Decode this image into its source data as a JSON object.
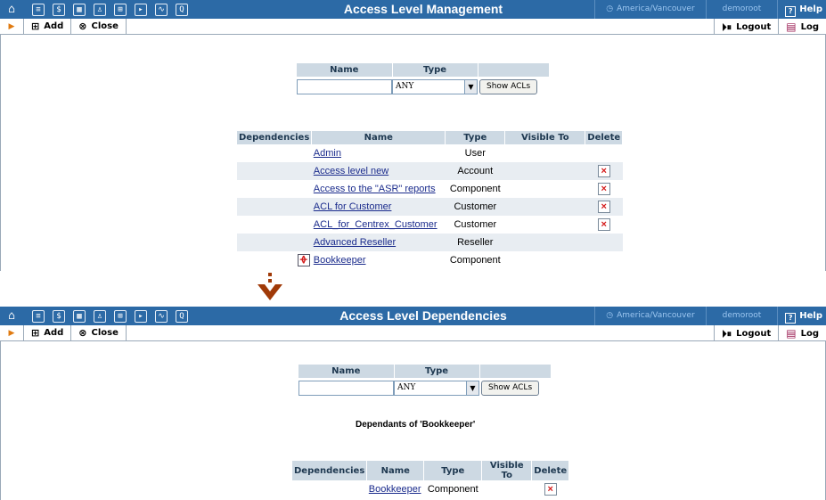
{
  "nav_icons": [
    {
      "name": "home-icon",
      "glyph": "⌂"
    },
    {
      "name": "list-icon",
      "glyph": "≡"
    },
    {
      "name": "dollar-icon",
      "glyph": "$"
    },
    {
      "name": "grid-icon",
      "glyph": "▦"
    },
    {
      "name": "person-icon",
      "glyph": "♙"
    },
    {
      "name": "tree-icon",
      "glyph": "⊞"
    },
    {
      "name": "forward-icon",
      "glyph": "▸"
    },
    {
      "name": "chart-icon",
      "glyph": "∿"
    },
    {
      "name": "search-icon",
      "glyph": "Q"
    }
  ],
  "timezone": "America/Vancouver",
  "user": "demoroot",
  "help_label": "Help",
  "toolbar": {
    "add_label": "Add",
    "close_label": "Close",
    "logout_label": "Logout",
    "log_label": "Log"
  },
  "search": {
    "name_header": "Name",
    "type_header": "Type",
    "name_value": "",
    "type_selected": "ANY",
    "show_label": "Show ACLs"
  },
  "headers": {
    "dependencies": "Dependencies",
    "name": "Name",
    "type": "Type",
    "visible_to": "Visible To",
    "delete": "Delete"
  },
  "top": {
    "title": "Access Level Management",
    "rows": [
      {
        "name": "Admin",
        "type": "User",
        "dependency": false,
        "deletable": false
      },
      {
        "name": "Access level new",
        "type": "Account",
        "dependency": false,
        "deletable": true
      },
      {
        "name": "Access to the \"ASR\" reports",
        "type": "Component",
        "dependency": false,
        "deletable": true
      },
      {
        "name": "ACL for Customer",
        "type": "Customer",
        "dependency": false,
        "deletable": true
      },
      {
        "name": "ACL_for_Centrex_Customer",
        "type": "Customer",
        "dependency": false,
        "deletable": true
      },
      {
        "name": "Advanced Reseller",
        "type": "Reseller",
        "dependency": false,
        "deletable": false
      },
      {
        "name": "Bookkeeper",
        "type": "Component",
        "dependency": true,
        "deletable": false
      }
    ]
  },
  "bottom": {
    "title": "Access Level Dependencies",
    "caption": "Dependants of 'Bookkeeper'",
    "rows": [
      {
        "name": "Bookkeeper",
        "type": "Component",
        "dependency": false,
        "deletable": true
      }
    ]
  },
  "colors": {
    "titlebar": "#2c6aa6",
    "header_cell": "#cdd9e3",
    "row_shade": "#e8edf2",
    "link": "#1a2b8c",
    "delete_x": "#d41a1a",
    "connector": "#a03a08"
  }
}
